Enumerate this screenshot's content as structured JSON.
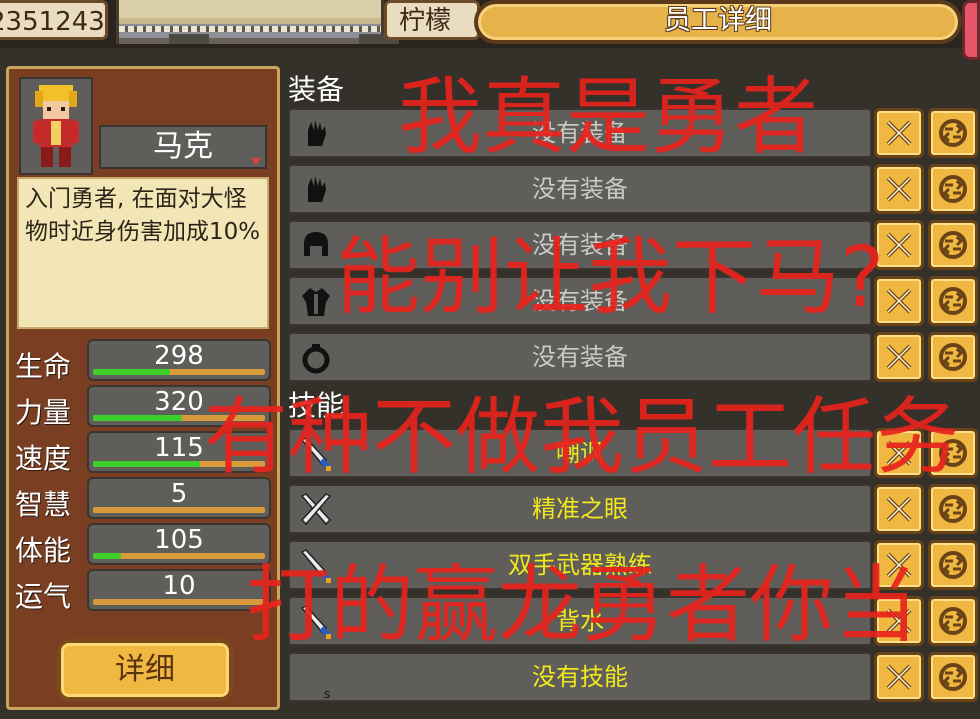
{
  "top_bar": {
    "money": "2351243",
    "city": "柠檬",
    "title": "员工详细"
  },
  "employee": {
    "name": "马克",
    "description": "入门勇者, 在面对大怪物时近身伤害加成10%",
    "detail_button": "详细",
    "stats": [
      {
        "label": "生命",
        "value": "298",
        "fill": 0.45
      },
      {
        "label": "力量",
        "value": "320",
        "fill": 0.52
      },
      {
        "label": "速度",
        "value": "115",
        "fill": 0.62
      },
      {
        "label": "智慧",
        "value": "5",
        "fill": 0.0
      },
      {
        "label": "体能",
        "value": "105",
        "fill": 0.16
      },
      {
        "label": "运气",
        "value": "10",
        "fill": 0.0
      }
    ]
  },
  "equipment": {
    "header": "装备",
    "slots": [
      {
        "icon": "gauntlet-icon",
        "text": "没有装备"
      },
      {
        "icon": "gauntlet-icon",
        "text": "没有装备"
      },
      {
        "icon": "helmet-icon",
        "text": "没有装备"
      },
      {
        "icon": "armor-icon",
        "text": "没有装备"
      },
      {
        "icon": "ring-icon",
        "text": "没有装备"
      }
    ]
  },
  "skills": {
    "header": "技能",
    "slots": [
      {
        "icon": "sword-icon",
        "text": "嘲讽"
      },
      {
        "icon": "crossed-swords-icon",
        "text": "精准之眼"
      },
      {
        "icon": "sword-icon",
        "text": "双手武器熟练"
      },
      {
        "icon": "sword-icon",
        "text": "背水"
      },
      {
        "icon": "empty-icon",
        "text": "没有技能"
      }
    ]
  },
  "overlay": {
    "lines": [
      "我真是勇者",
      "能别让我下马?",
      "有种不做我员工任务",
      "打的赢龙勇者你当"
    ]
  }
}
